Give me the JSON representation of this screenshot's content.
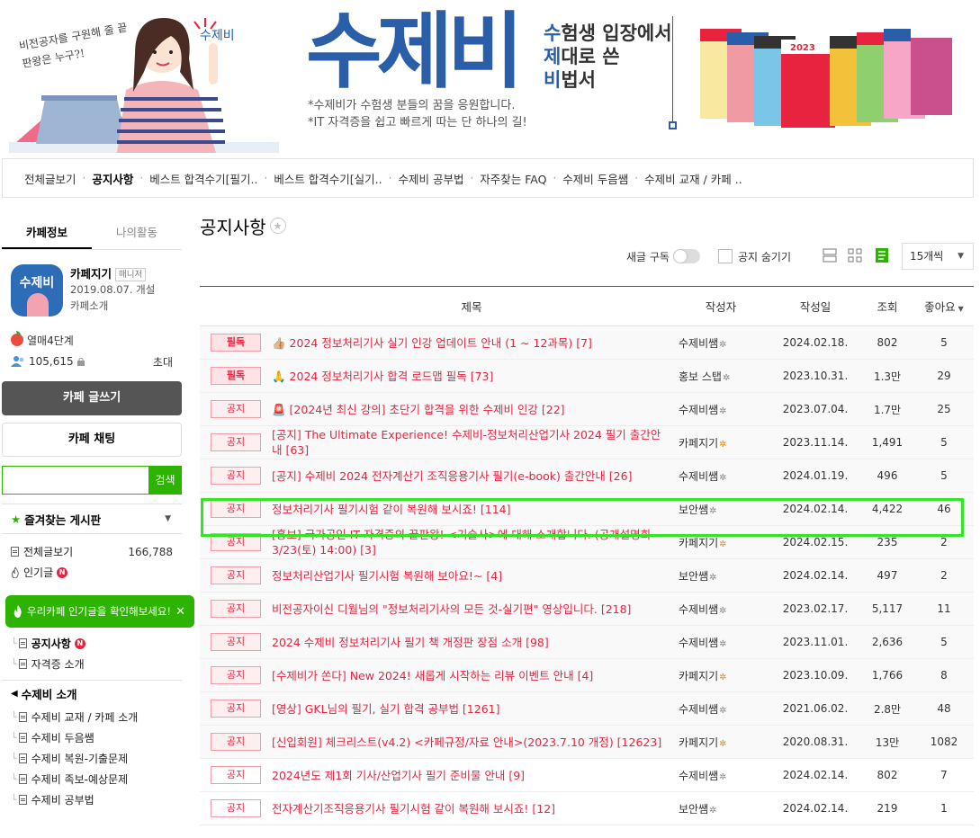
{
  "banner": {
    "handwriting": "비전공자를 구원해 줄 끝판왕은 누구?!",
    "speech": "수제비",
    "logo": "수제비",
    "tagline": [
      {
        "lead": "수",
        "rest": "험생 입장에서"
      },
      {
        "lead": "제",
        "rest": "대로 쓴"
      },
      {
        "lead": "비",
        "rest": "법서"
      }
    ],
    "sub1": "*수제비가 수험생 분들의 꿈을 응원합니다.",
    "sub2": "*IT 자격증을 쉽고 빠르게 따는 단 하나의 길!",
    "book_year": "2023"
  },
  "nav": [
    {
      "label": "전체글보기",
      "active": false
    },
    {
      "label": "공지사항",
      "active": true
    },
    {
      "label": "베스트 합격수기[필기..",
      "active": false
    },
    {
      "label": "베스트 합격수기[실기..",
      "active": false
    },
    {
      "label": "수제비 공부법",
      "active": false
    },
    {
      "label": "자주찾는 FAQ",
      "active": false
    },
    {
      "label": "수제비 두음쌤",
      "active": false
    },
    {
      "label": "수제비 교재 / 카페 ..",
      "active": false
    }
  ],
  "sidebar": {
    "tab_info": "카페정보",
    "tab_activity": "나의활동",
    "logo_text": "수제비",
    "manager": "카페지기",
    "manager_badge": "매니저",
    "created": "2019.08.07. 개설",
    "intro": "카페소개",
    "level": "열매4단계",
    "members": "105,615",
    "invite": "초대",
    "write_btn": "카페 글쓰기",
    "chat_btn": "카페 채팅",
    "search_btn": "검색",
    "fav_title": "즐겨찾는 게시판",
    "all_posts": "전체글보기",
    "all_count": "166,788",
    "popular": "인기글",
    "new_badge": "N",
    "tooltip": "우리카페 인기글을 확인해보세요!",
    "notice_board": "공지사항",
    "cert_intro": "자격증 소개",
    "section_title": "수제비 소개",
    "section_items": [
      "수제비 교재 / 카페 소개",
      "수제비 두음쌤",
      "수제비 복원-기출문제",
      "수제비 족보-예상문제",
      "수제비 공부법"
    ]
  },
  "main": {
    "title": "공지사항",
    "subscribe_label": "새글 구독",
    "hide_notice_label": "공지 숨기기",
    "per_page": "15개씩",
    "headers": {
      "title": "제목",
      "author": "작성자",
      "date": "작성일",
      "views": "조회",
      "likes": "좋아요"
    },
    "rows": [
      {
        "tag": "필독",
        "style": "pin",
        "title": "👍🏼 2024 정보처리기사 실기 인강 업데이트 안내 (1 ~ 12과목) [7]",
        "author": "수제비쌤",
        "gear": "g",
        "date": "2024.02.18.",
        "views": "802",
        "likes": "5"
      },
      {
        "tag": "필독",
        "style": "pin",
        "title": "🙏 2024 정보처리기사 합격 로드맵 필독 [73]",
        "author": "홍보 스탭",
        "gear": "g",
        "date": "2023.10.31.",
        "views": "1.3만",
        "likes": "29"
      },
      {
        "tag": "공지",
        "style": "n",
        "title": "🚨 [2024년 최신 강의] 초단기 합격을 위한 수제비 인강 [22]",
        "author": "수제비쌤",
        "gear": "g",
        "date": "2023.07.04.",
        "views": "1.7만",
        "likes": "25"
      },
      {
        "tag": "공지",
        "style": "n",
        "title": "[공지] The Ultimate Experience! 수제비-정보처리산업기사 2024 필기 출간안내 [63]",
        "author": "카페지기",
        "gear": "o",
        "date": "2023.11.14.",
        "views": "1,491",
        "likes": "5"
      },
      {
        "tag": "공지",
        "style": "n",
        "title": "[공지] 수제비 2024 전자계산기 조직응용기사 필기(e-book) 출간안내 [26]",
        "author": "수제비쌤",
        "gear": "g",
        "date": "2024.01.19.",
        "views": "496",
        "likes": "5"
      },
      {
        "tag": "공지",
        "style": "n",
        "title": "정보처리기사 필기시험 같이 복원해 보시죠! [114]",
        "author": "보안쌤",
        "gear": "g",
        "date": "2024.02.14.",
        "views": "4,422",
        "likes": "46"
      },
      {
        "tag": "공지",
        "style": "n",
        "title": "[홍보] 국가공인 IT 자격증의 끝판왕! <기술사>에 대해 소개합니다. (공개설명회 3/23(토) 14:00) [3]",
        "author": "카페지기",
        "gear": "o",
        "date": "2024.02.15.",
        "views": "235",
        "likes": "2"
      },
      {
        "tag": "공지",
        "style": "n",
        "title": "정보처리산업기사 필기시험 복원해 보아요!~ [4]",
        "author": "보안쌤",
        "gear": "g",
        "date": "2024.02.14.",
        "views": "497",
        "likes": "2"
      },
      {
        "tag": "공지",
        "style": "n",
        "title": "비전공자이신 디월님의 \"정보처리기사의 모든 것-실기편\" 영상입니다. [218]",
        "author": "수제비쌤",
        "gear": "g",
        "date": "2023.02.17.",
        "views": "5,117",
        "likes": "11"
      },
      {
        "tag": "공지",
        "style": "n",
        "title": "2024 수제비 정보처리기사 필기 책 개정판 장점 소개 [98]",
        "author": "수제비쌤",
        "gear": "g",
        "date": "2023.11.01.",
        "views": "2,636",
        "likes": "5"
      },
      {
        "tag": "공지",
        "style": "n",
        "title": "[수제비가 쏜다] New 2024! 새롭게 시작하는 리뷰 이벤트 안내 [4]",
        "author": "카페지기",
        "gear": "o",
        "date": "2023.10.09.",
        "views": "1,766",
        "likes": "8"
      },
      {
        "tag": "공지",
        "style": "n",
        "title": "[영상] GKL님의 필기, 실기 합격 공부법 [1261]",
        "author": "수제비쌤",
        "gear": "g",
        "date": "2021.06.02.",
        "views": "2.8만",
        "likes": "48"
      },
      {
        "tag": "공지",
        "style": "n",
        "title": "[신입회원] 체크리스트(v4.2) <카페규정/자료 안내>(2023.7.10 개정) [12623]",
        "author": "카페지기",
        "gear": "o",
        "date": "2020.08.31.",
        "views": "13만",
        "likes": "1082"
      },
      {
        "tag": "공지",
        "style": "w",
        "title": "2024년도 제1회 기사/산업기사 필기 준비물 안내 [9]",
        "author": "수제비쌤",
        "gear": "g",
        "date": "2024.02.14.",
        "views": "802",
        "likes": "7"
      },
      {
        "tag": "공지",
        "style": "w",
        "title": "전자계산기조직응용기사 필기시험 같이 복원해 보시죠! [12]",
        "author": "보안쌤",
        "gear": "g",
        "date": "2024.02.14.",
        "views": "219",
        "likes": "1"
      }
    ]
  },
  "colors": {
    "accent": "#2db400",
    "notice_red": "#e8233f",
    "brand_blue": "#2a5ea8",
    "highlight": "#33e625"
  }
}
